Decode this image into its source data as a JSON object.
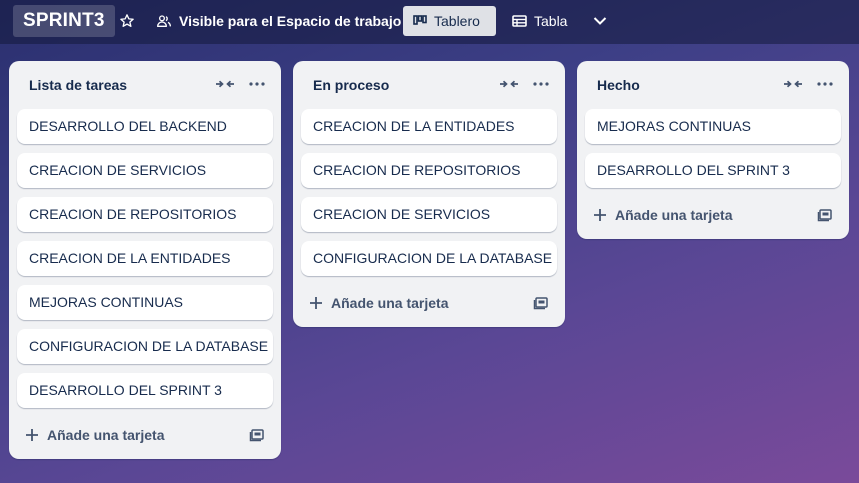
{
  "board": {
    "name": "SPRINT3",
    "visibility_label": "Visible para el Espacio de trabajo",
    "views": [
      {
        "label": "Tablero",
        "icon": "board-icon",
        "active": true
      },
      {
        "label": "Tabla",
        "icon": "table-icon",
        "active": false
      }
    ]
  },
  "lists": [
    {
      "title": "Lista de tareas",
      "cards": [
        "DESARROLLO DEL BACKEND",
        "CREACION DE SERVICIOS",
        "CREACION DE REPOSITORIOS",
        "CREACION DE LA ENTIDADES",
        "MEJORAS CONTINUAS",
        "CONFIGURACION DE LA DATABASE",
        "DESARROLLO DEL SPRINT 3"
      ],
      "add_card_label": "Añade una tarjeta"
    },
    {
      "title": "En proceso",
      "cards": [
        "CREACION DE LA ENTIDADES",
        "CREACION DE REPOSITORIOS",
        "CREACION DE SERVICIOS",
        "CONFIGURACION DE LA DATABASE"
      ],
      "add_card_label": "Añade una tarjeta"
    },
    {
      "title": "Hecho",
      "cards": [
        "MEJORAS CONTINUAS",
        "DESARROLLO DEL SPRINT 3"
      ],
      "add_card_label": "Añade una tarjeta"
    }
  ],
  "colors": {
    "list_bg": "#f1f2f4",
    "card_bg": "#ffffff",
    "text": "#172b4d",
    "active_view_bg": "#dfe1e6"
  }
}
